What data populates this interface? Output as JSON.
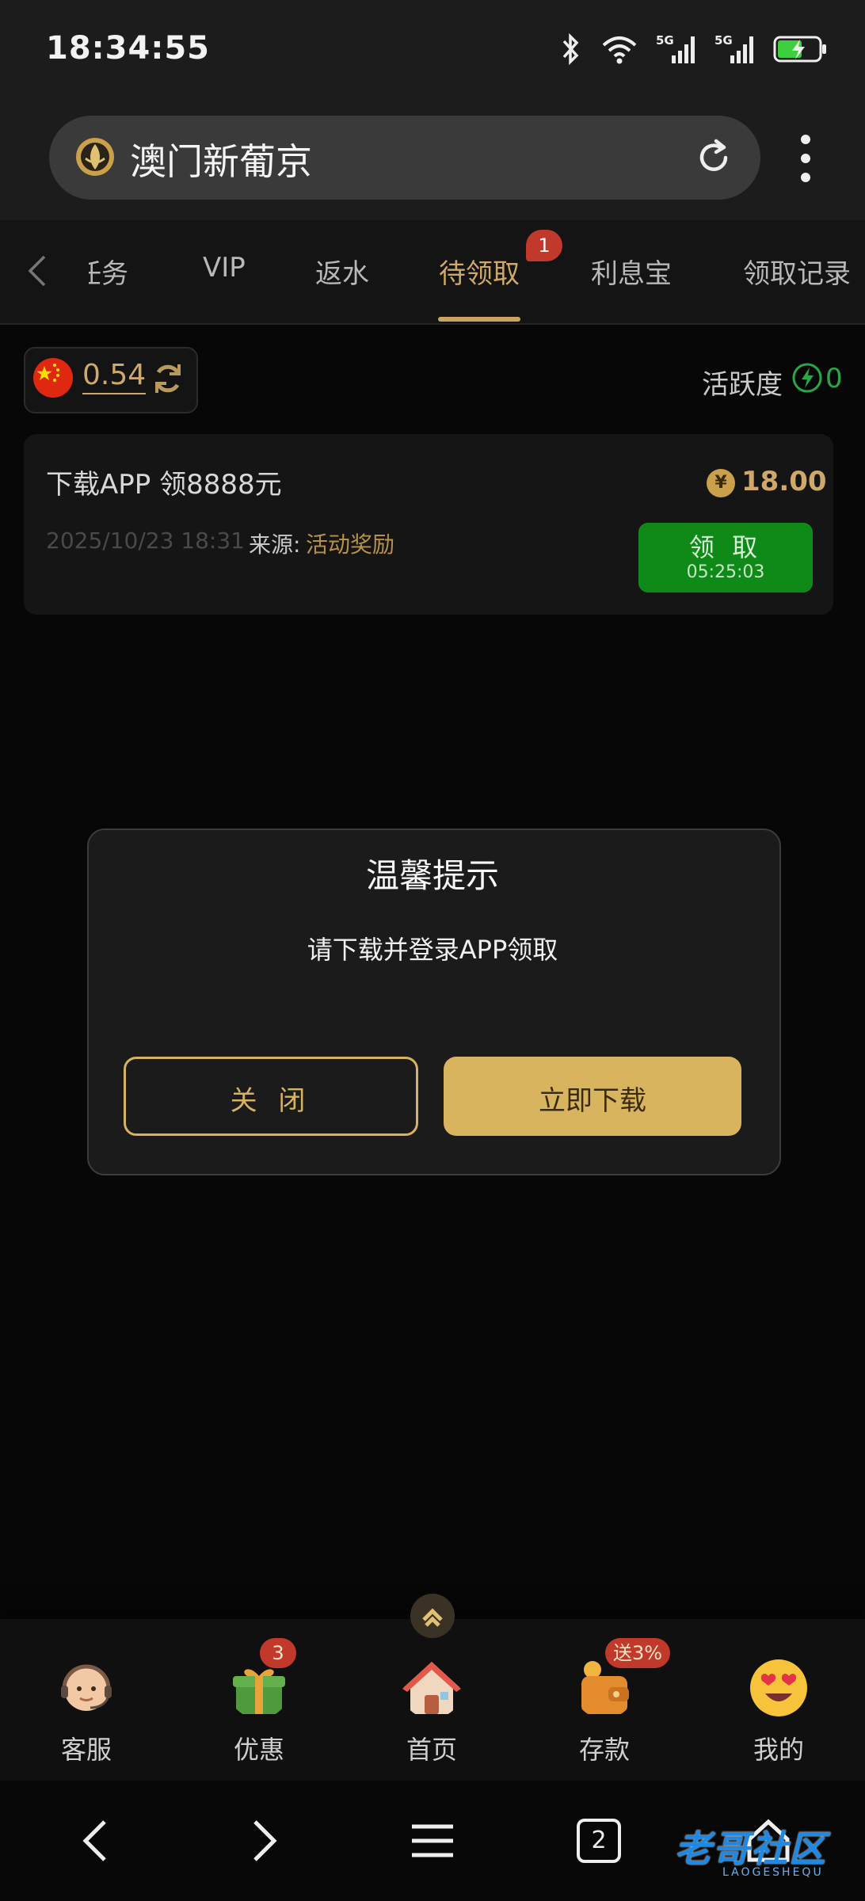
{
  "status_bar": {
    "time": "18:34:55",
    "net1": "5G",
    "net2": "5G"
  },
  "browser": {
    "title": "澳门新葡京",
    "tab_count": "2"
  },
  "tabs": [
    {
      "label": "任务",
      "active": false
    },
    {
      "label": "VIP",
      "active": false
    },
    {
      "label": "返水",
      "active": false
    },
    {
      "label": "待领取",
      "active": true,
      "badge": "1"
    },
    {
      "label": "利息宝",
      "active": false
    },
    {
      "label": "领取记录",
      "active": false
    }
  ],
  "balance": {
    "value": "0.54"
  },
  "activity": {
    "label": "活跃度",
    "value": "0"
  },
  "reward": {
    "title": "下载APP 领8888元",
    "amount": "18.00",
    "coin_symbol": "¥",
    "date": "2025/10/23 18:31",
    "source_label": "来源:",
    "source": "活动奖励",
    "claim_label": "领 取",
    "timer": "05:25:03"
  },
  "modal": {
    "title": "温馨提示",
    "message": "请下载并登录APP领取",
    "close_label": "关 闭",
    "download_label": "立即下载"
  },
  "bottom_nav": [
    {
      "label": "客服",
      "icon": "customer-service-icon"
    },
    {
      "label": "优惠",
      "icon": "gift-icon",
      "badge": "3"
    },
    {
      "label": "首页",
      "icon": "home-icon"
    },
    {
      "label": "存款",
      "icon": "wallet-icon",
      "badge": "送3%"
    },
    {
      "label": "我的",
      "icon": "profile-emoji-icon"
    }
  ],
  "watermark": {
    "text": "老哥社区",
    "sub": "LAOGESHEQU"
  },
  "colors": {
    "gold": "#cfa96a",
    "green": "#0f8a18",
    "badge_red": "#c0392b"
  }
}
